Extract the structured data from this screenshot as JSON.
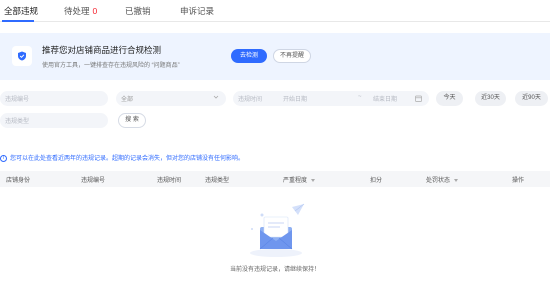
{
  "tabs": [
    {
      "label": "全部违规",
      "count": ""
    },
    {
      "label": "待处理",
      "count": "0"
    },
    {
      "label": "已撤销",
      "count": ""
    },
    {
      "label": "申诉记录",
      "count": ""
    }
  ],
  "banner": {
    "title": "推荐您对店铺商品进行合规检测",
    "description": "使用官方工具，一键排查存在违规风险的 “问题商品”",
    "primary_button": "去检测",
    "secondary_button": "不再提醒"
  },
  "filters": {
    "violation_no_placeholder": "违规编号",
    "select_value": "全部",
    "time_label": "违规时间",
    "start_placeholder": "开始日期",
    "range_separator": "~",
    "end_placeholder": "结束日期",
    "today": "今天",
    "last30": "近30天",
    "last90": "近90天",
    "type_placeholder": "违规类型",
    "search_button": "搜 索"
  },
  "notice": "您可以在此处查看近两年的违规记录。超期的记录会消失，但对您的店铺没有任何影响。",
  "table": {
    "columns": [
      "店铺身份",
      "违规编号",
      "违规时间",
      "违规类型",
      "严重程度",
      "扣分",
      "处罚状态",
      "操作"
    ]
  },
  "empty_state": {
    "text": "当前没有违规记录，请继续保持！"
  },
  "colors": {
    "accent": "#2f6bff",
    "badge": "#f5222d",
    "banner_bg": "#eef4ff"
  }
}
